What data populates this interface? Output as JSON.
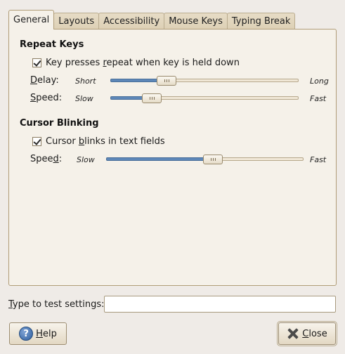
{
  "tabs": [
    {
      "label": "General",
      "active": true
    },
    {
      "label": "Layouts",
      "active": false
    },
    {
      "label": "Accessibility",
      "active": false
    },
    {
      "label": "Mouse Keys",
      "active": false
    },
    {
      "label": "Typing Break",
      "active": false
    }
  ],
  "repeat_keys": {
    "title": "Repeat Keys",
    "checkbox_label_pre": "Key presses ",
    "checkbox_label_mnemonic": "r",
    "checkbox_label_post": "epeat when key is held down",
    "checked": true,
    "delay": {
      "label_mnemonic": "D",
      "label_rest": "elay:",
      "min_label": "Short",
      "max_label": "Long",
      "value": 0.3
    },
    "speed": {
      "label_mnemonic": "S",
      "label_rest": "peed:",
      "min_label": "Slow",
      "max_label": "Fast",
      "value": 0.22
    }
  },
  "cursor_blinking": {
    "title": "Cursor Blinking",
    "checkbox_label_pre": "Cursor ",
    "checkbox_label_mnemonic": "b",
    "checkbox_label_post": "links in text fields",
    "checked": true,
    "speed": {
      "label_pre": "Spee",
      "label_mnemonic": "d",
      "label_post": ":",
      "min_label": "Slow",
      "max_label": "Fast",
      "value": 0.54
    }
  },
  "test_field": {
    "label_mnemonic": "T",
    "label_rest": "ype to test settings:",
    "value": ""
  },
  "buttons": {
    "help_mnemonic": "H",
    "help_rest": "elp",
    "close_mnemonic": "C",
    "close_rest": "lose"
  },
  "colors": {
    "slider_fill": "#5d87b8",
    "window_bg": "#efebe7",
    "panel_bg": "#f5f1e9"
  }
}
